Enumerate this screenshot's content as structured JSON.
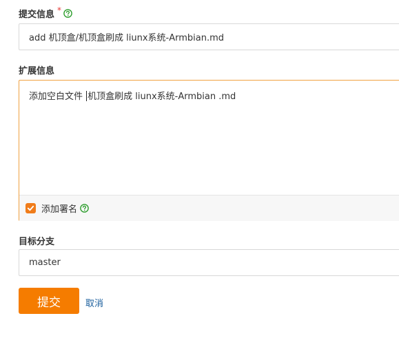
{
  "commit": {
    "label": "提交信息",
    "required_mark": "*",
    "value": "add 机顶盒/机顶盒刷成 liunx系统-Armbian.md"
  },
  "extended": {
    "label": "扩展信息",
    "text_before_caret": "添加空白文件 ",
    "text_after_caret": "机顶盒刷成 liunx系统-Armbian .md"
  },
  "signature": {
    "label": "添加署名",
    "checked": true
  },
  "branch": {
    "label": "目标分支",
    "value": "master"
  },
  "actions": {
    "submit_label": "提交",
    "cancel_label": "取消"
  },
  "colors": {
    "accent": "#f57c00",
    "help_icon": "#2e9e2e",
    "required": "#e53935",
    "link": "#1a5e9c",
    "focus_border": "#f0a040"
  }
}
